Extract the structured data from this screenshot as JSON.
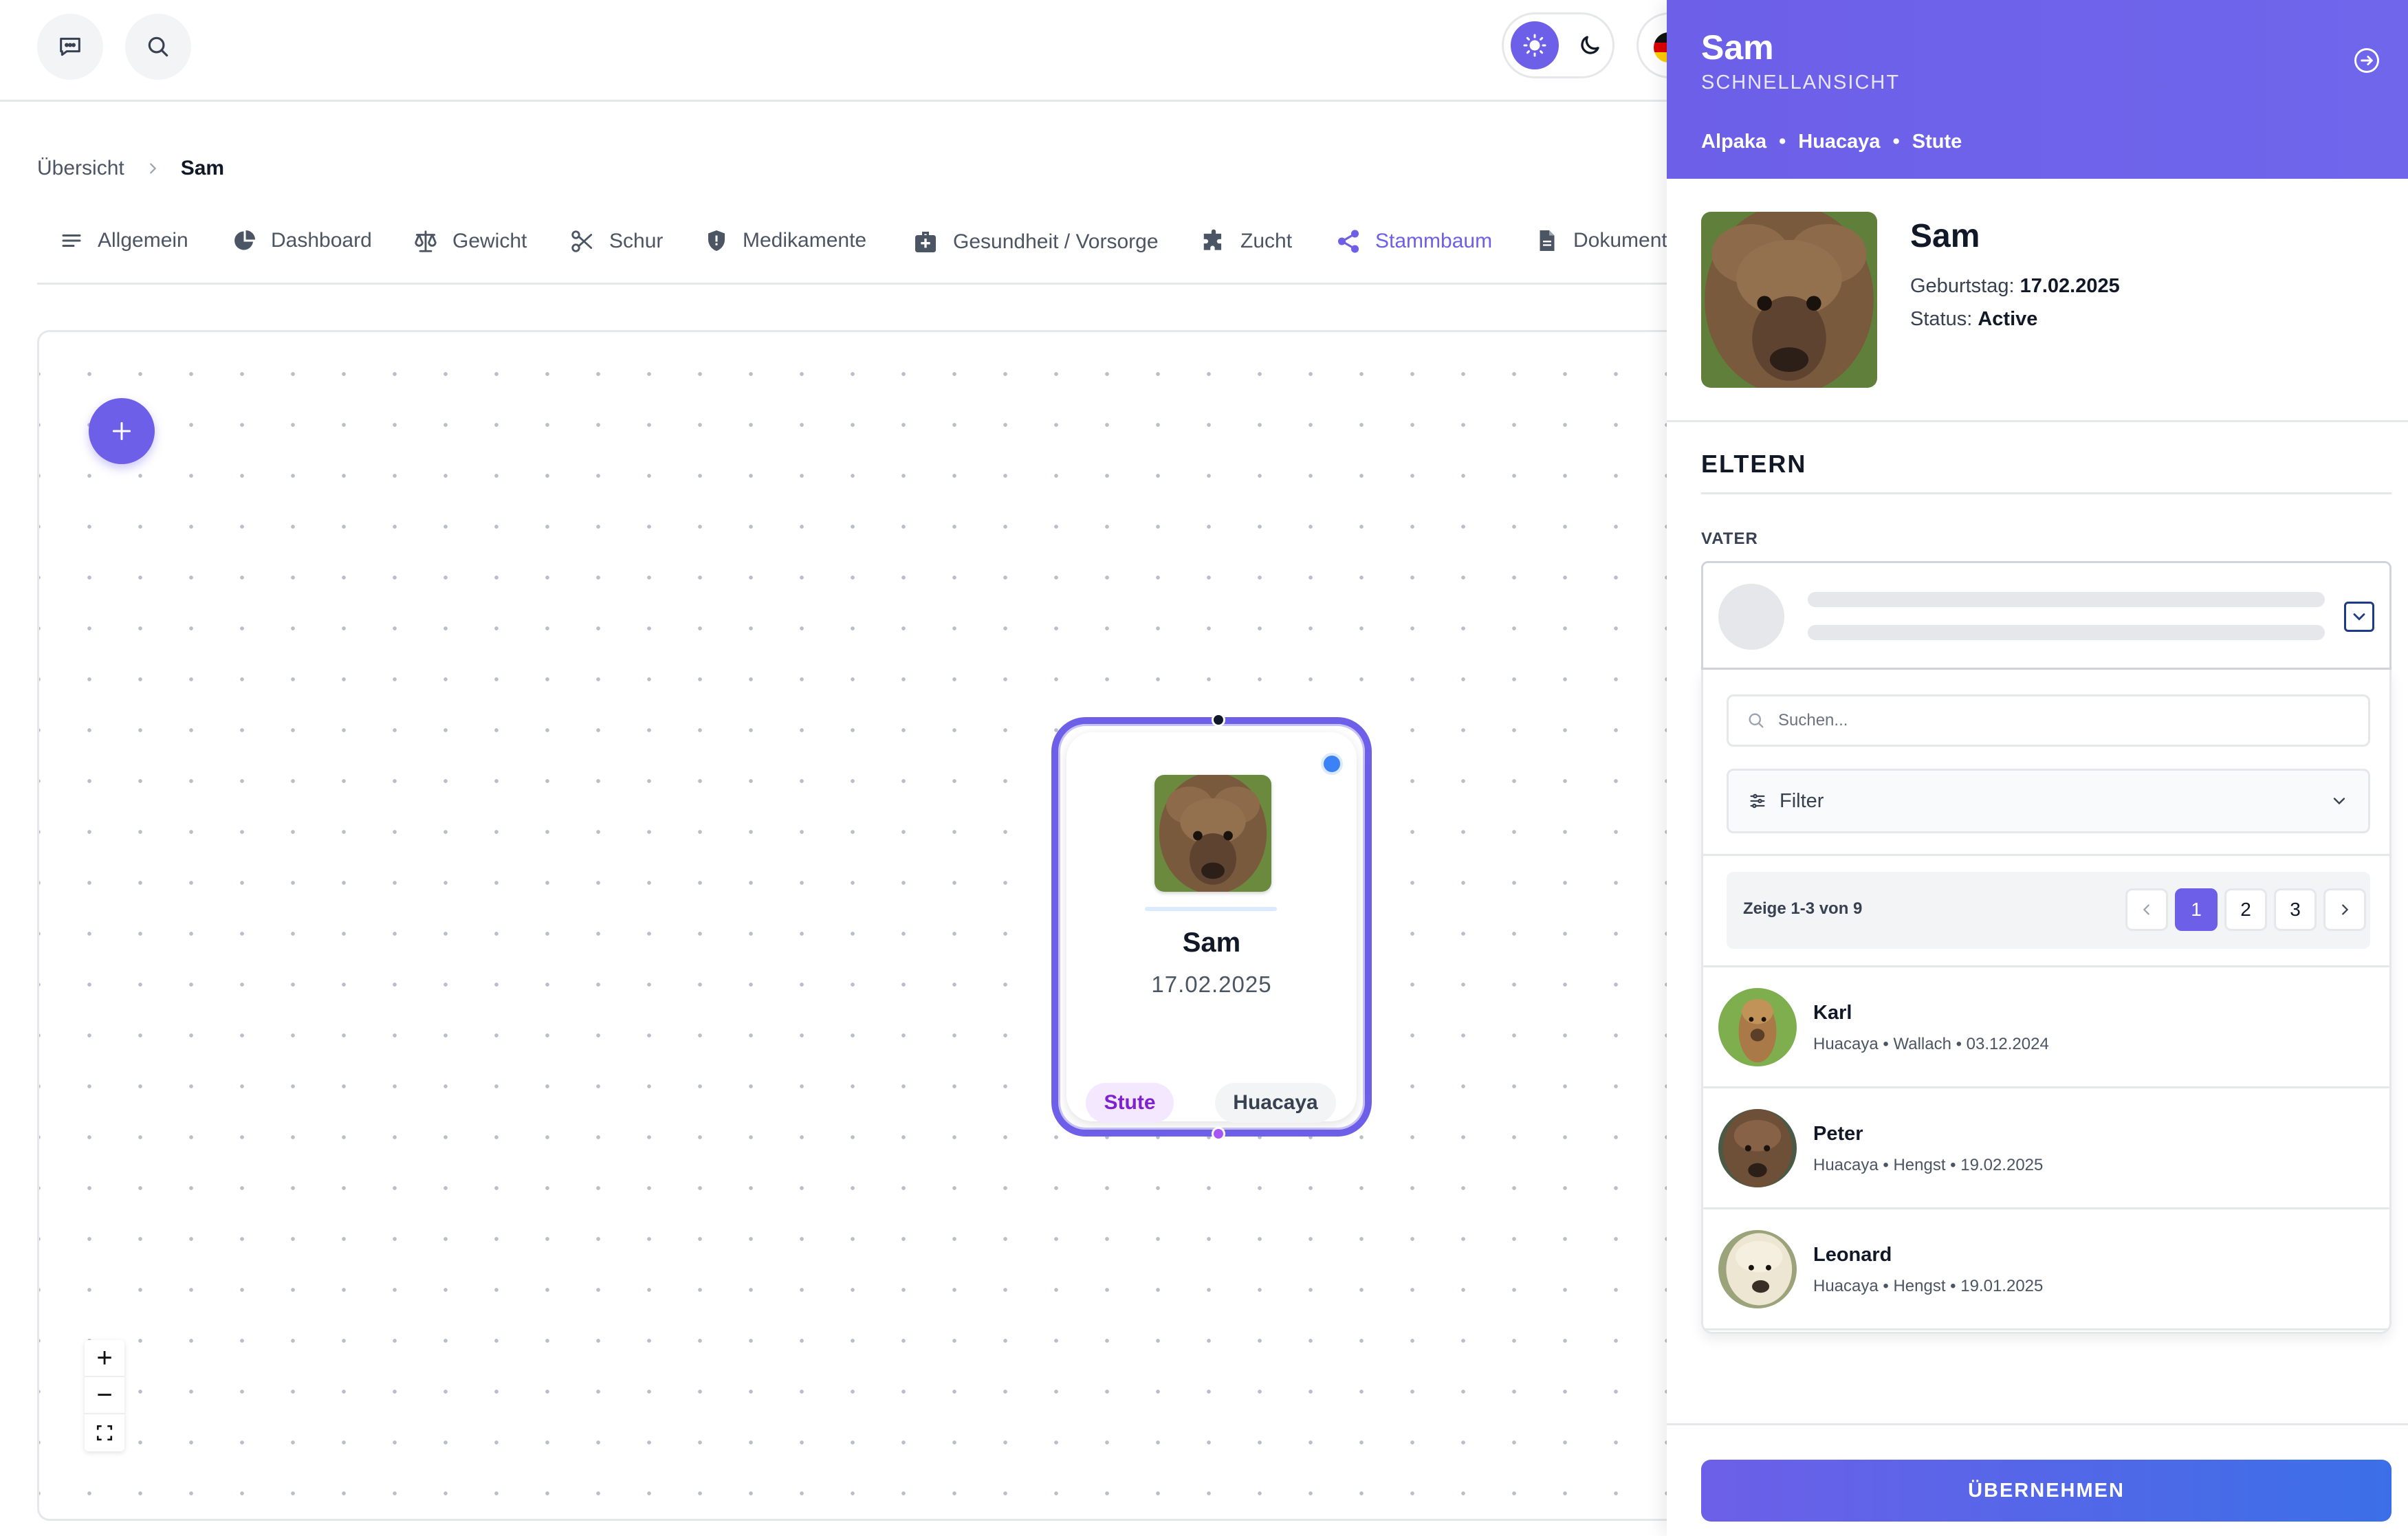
{
  "topbar": {
    "chat_icon": "chat-bubble-icon",
    "search_icon": "search-icon",
    "theme": {
      "light_icon": "sun-icon",
      "dark_icon": "moon-icon",
      "active": "light"
    },
    "language_flag": "german-flag-icon"
  },
  "breadcrumb": {
    "items": [
      "Übersicht",
      "Sam"
    ]
  },
  "tabs": [
    {
      "label": "Allgemein",
      "icon": "lines-icon"
    },
    {
      "label": "Dashboard",
      "icon": "pie-chart-icon"
    },
    {
      "label": "Gewicht",
      "icon": "scale-icon"
    },
    {
      "label": "Schur",
      "icon": "scissors-icon"
    },
    {
      "label": "Medikamente",
      "icon": "shield-icon"
    },
    {
      "label": "Gesundheit / Vorsorge",
      "icon": "first-aid-kit-icon"
    },
    {
      "label": "Zucht",
      "icon": "puzzle-icon"
    },
    {
      "label": "Stammbaum",
      "icon": "share-icon",
      "active": true
    },
    {
      "label": "Dokumente",
      "icon": "document-icon"
    }
  ],
  "canvas": {
    "add_icon": "plus-icon",
    "zoom": {
      "in": "+",
      "out": "−",
      "fit_icon": "fit-view-icon"
    },
    "node": {
      "name": "Sam",
      "date": "17.02.2025",
      "sex_tag": "Stute",
      "breed_tag": "Huacaya",
      "status_color": "#3b82f6"
    }
  },
  "panel": {
    "title": "Sam",
    "subtitle": "SCHNELLANSICHT",
    "meta": [
      "Alpaka",
      "Huacaya",
      "Stute"
    ],
    "meta_separator": "•",
    "close_icon": "arrow-right-circle-icon",
    "profile": {
      "name": "Sam",
      "birthday_label": "Geburtstag:",
      "birthday": "17.02.2025",
      "status_label": "Status:",
      "status": "Active"
    },
    "section_title": "ELTERN",
    "father": {
      "label": "VATER",
      "search_placeholder": "Suchen...",
      "filter_label": "Filter",
      "pagination": {
        "info": "Zeige 1-3 von 9",
        "pages": [
          "1",
          "2",
          "3"
        ],
        "current": "1"
      },
      "options": [
        {
          "name": "Karl",
          "meta": "Huacaya • Wallach • 03.12.2024"
        },
        {
          "name": "Peter",
          "meta": "Huacaya • Hengst • 19.02.2025"
        },
        {
          "name": "Leonard",
          "meta": "Huacaya • Hengst • 19.01.2025"
        }
      ]
    },
    "apply_label": "ÜBERNEHMEN"
  },
  "colors": {
    "accent": "#6d5fe8",
    "apply_gradient_end": "#3b6fe8",
    "sex_tag_bg": "#f3e8ff",
    "sex_tag_text": "#7e22ce"
  }
}
